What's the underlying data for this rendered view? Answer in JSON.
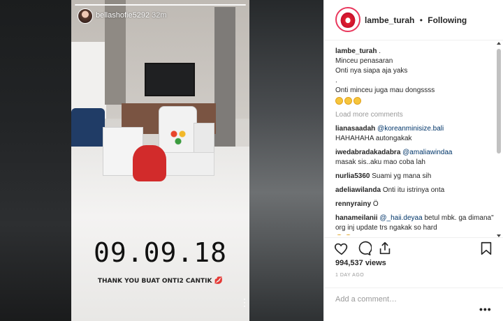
{
  "story": {
    "username": "bellashofie5292",
    "time": "32m",
    "date_text": "09.09.18",
    "caption_text": "THANK YOU BUAT ONTI2 CANTIK",
    "more_glyph": "⋮"
  },
  "post": {
    "author": "lambe_turah",
    "separator": "•",
    "follow_status": "Following",
    "caption": {
      "username": "lambe_turah",
      "text_suffix": ".",
      "lines": [
        "Minceu penasaran",
        "Onti nya siapa aja yaks",
        ".",
        "Onti minceu juga mau dongssss"
      ],
      "emoji_count": 3
    },
    "load_more_label": "Load more comments",
    "comments": [
      {
        "user": "lianasaadah",
        "mention": "@koreanminisize.bali",
        "text": "HAHAHAHA autongakak"
      },
      {
        "user": "iwedabradakadabra",
        "mention": "@amaliawindaa",
        "text": "masak sis..aku mao coba lah"
      },
      {
        "user": "nurlia5360",
        "mention": "",
        "text": "Suami yg mana sih"
      },
      {
        "user": "adeliawilanda",
        "mention": "",
        "text": "Onti itu istrinya onta"
      },
      {
        "user": "rennyrainy",
        "mention": "",
        "text": "Ö"
      },
      {
        "user": "hanameilanii",
        "mention": "@_haii.deyaa",
        "text": "betul mbk. ga dimana\" org inj update trs ngakak so hard"
      }
    ],
    "last_comment_emoji_count": 2,
    "views": "994,537 views",
    "posted_ago": "1 DAY AGO",
    "add_comment_placeholder": "Add a comment…",
    "more_options": "•••"
  },
  "icons": {
    "like": "heart-icon",
    "comment": "comment-bubble-icon",
    "share": "share-icon",
    "save": "bookmark-icon"
  },
  "colors": {
    "accent_ring": "#e9385d",
    "mention": "#003569",
    "muted": "#999999"
  }
}
